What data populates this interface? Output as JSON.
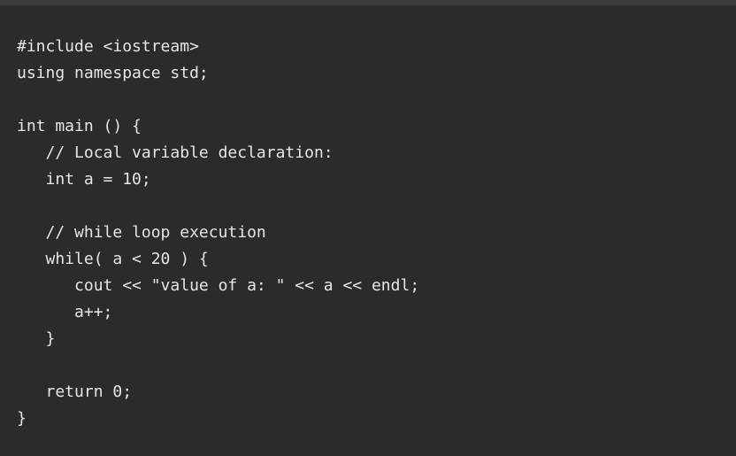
{
  "code": {
    "lines": [
      "#include <iostream>",
      "using namespace std;",
      "",
      "int main () {",
      "   // Local variable declaration:",
      "   int a = 10;",
      "",
      "   // while loop execution",
      "   while( a < 20 ) {",
      "      cout << \"value of a: \" << a << endl;",
      "      a++;",
      "   }",
      "",
      "   return 0;",
      "}"
    ]
  }
}
